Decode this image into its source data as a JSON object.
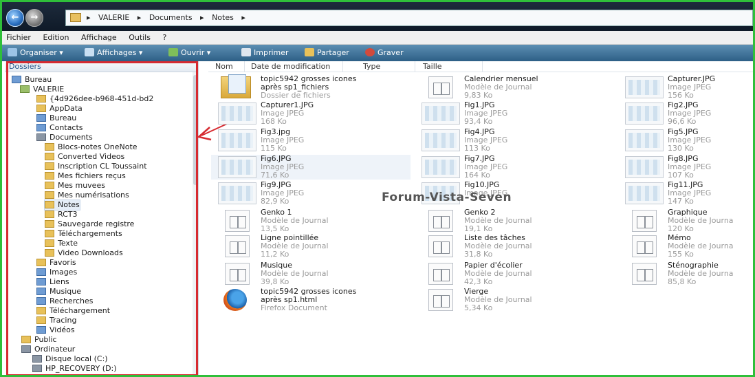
{
  "address": {
    "breadcrumbs": [
      "VALERIE",
      "Documents",
      "Notes"
    ]
  },
  "menu": [
    "Fichier",
    "Edition",
    "Affichage",
    "Outils",
    "?"
  ],
  "toolbar": {
    "organize": "Organiser",
    "views": "Affichages",
    "open": "Ouvrir",
    "print": "Imprimer",
    "share": "Partager",
    "burn": "Graver"
  },
  "left_pane": {
    "header": "Dossiers",
    "items": [
      {
        "label": "Bureau",
        "icon": "folder-blue-icon"
      },
      {
        "label": "VALERIE",
        "icon": "user-folder-icon"
      },
      {
        "label": "{4d926dee-b968-451d-bd2",
        "icon": "folder-icon"
      },
      {
        "label": "AppData",
        "icon": "folder-icon"
      },
      {
        "label": "Bureau",
        "icon": "folder-blue-icon"
      },
      {
        "label": "Contacts",
        "icon": "contacts-icon"
      },
      {
        "label": "Documents",
        "icon": "documents-icon"
      },
      {
        "label": "Blocs-notes OneNote",
        "icon": "folder-icon"
      },
      {
        "label": "Converted Videos",
        "icon": "folder-icon"
      },
      {
        "label": "Inscription CL Toussaint",
        "icon": "folder-icon"
      },
      {
        "label": "Mes fichiers reçus",
        "icon": "folder-icon"
      },
      {
        "label": "Mes muvees",
        "icon": "folder-icon"
      },
      {
        "label": "Mes numérisations",
        "icon": "folder-icon"
      },
      {
        "label": "Notes",
        "icon": "folder-icon"
      },
      {
        "label": "RCT3",
        "icon": "folder-icon"
      },
      {
        "label": "Sauvegarde registre",
        "icon": "folder-icon"
      },
      {
        "label": "Téléchargements",
        "icon": "folder-icon"
      },
      {
        "label": "Texte",
        "icon": "folder-icon"
      },
      {
        "label": "Video Downloads",
        "icon": "folder-icon"
      },
      {
        "label": "Favoris",
        "icon": "favorites-icon"
      },
      {
        "label": "Images",
        "icon": "images-icon"
      },
      {
        "label": "Liens",
        "icon": "links-icon"
      },
      {
        "label": "Musique",
        "icon": "music-icon"
      },
      {
        "label": "Recherches",
        "icon": "searches-icon"
      },
      {
        "label": "Téléchargement",
        "icon": "folder-icon"
      },
      {
        "label": "Tracing",
        "icon": "folder-icon"
      },
      {
        "label": "Vidéos",
        "icon": "videos-icon"
      },
      {
        "label": "Public",
        "icon": "folder-icon"
      },
      {
        "label": "Ordinateur",
        "icon": "computer-icon"
      },
      {
        "label": "Disque local (C:)",
        "icon": "drive-icon"
      },
      {
        "label": "HP_RECOVERY (D:)",
        "icon": "drive-icon"
      }
    ]
  },
  "columns": [
    "Nom",
    "Date de modification",
    "Type",
    "Taille"
  ],
  "files": [
    {
      "name": "topic5942 grosses icones",
      "name2": "après sp1_fichiers",
      "type": "Dossier de fichiers",
      "size": "",
      "icon": "folder-icon"
    },
    {
      "name": "Calendrier mensuel",
      "type": "Modèle de Journal",
      "size": "9,83 Ko",
      "icon": "journal-icon"
    },
    {
      "name": "Capturer.JPG",
      "type": "Image JPEG",
      "size": "156 Ko",
      "icon": "jpeg-icon"
    },
    {
      "name": "Capturer1.JPG",
      "type": "Image JPEG",
      "size": "168 Ko",
      "icon": "jpeg-icon"
    },
    {
      "name": "Fig1.JPG",
      "type": "Image JPEG",
      "size": "93,4 Ko",
      "icon": "jpeg-icon"
    },
    {
      "name": "Fig2.JPG",
      "type": "Image JPEG",
      "size": "96,6 Ko",
      "icon": "jpeg-icon"
    },
    {
      "name": "Fig3.jpg",
      "type": "Image JPEG",
      "size": "115 Ko",
      "icon": "jpeg-icon"
    },
    {
      "name": "Fig4.JPG",
      "type": "Image JPEG",
      "size": "113 Ko",
      "icon": "jpeg-icon"
    },
    {
      "name": "Fig5.JPG",
      "type": "Image JPEG",
      "size": "130 Ko",
      "icon": "jpeg-icon"
    },
    {
      "name": "Fig6.JPG",
      "type": "Image JPEG",
      "size": "71,6 Ko",
      "icon": "jpeg-icon"
    },
    {
      "name": "Fig7.JPG",
      "type": "Image JPEG",
      "size": "164 Ko",
      "icon": "jpeg-icon"
    },
    {
      "name": "Fig8.JPG",
      "type": "Image JPEG",
      "size": "107 Ko",
      "icon": "jpeg-icon"
    },
    {
      "name": "Fig9.JPG",
      "type": "Image JPEG",
      "size": "82,9 Ko",
      "icon": "jpeg-icon"
    },
    {
      "name": "Fig10.JPG",
      "type": "Image JPEG",
      "size": "",
      "icon": "jpeg-icon"
    },
    {
      "name": "Fig11.JPG",
      "type": "Image JPEG",
      "size": "147 Ko",
      "icon": "jpeg-icon"
    },
    {
      "name": "Genko 1",
      "type": "Modèle de Journal",
      "size": "13,5 Ko",
      "icon": "journal-icon"
    },
    {
      "name": "Genko 2",
      "type": "Modèle de Journal",
      "size": "19,1 Ko",
      "icon": "journal-icon"
    },
    {
      "name": "Graphique",
      "type": "Modèle de Journa",
      "size": "120 Ko",
      "icon": "journal-icon"
    },
    {
      "name": "Ligne pointillée",
      "type": "Modèle de Journal",
      "size": "11,2 Ko",
      "icon": "journal-icon"
    },
    {
      "name": "Liste des tâches",
      "type": "Modèle de Journal",
      "size": "31,8 Ko",
      "icon": "journal-icon"
    },
    {
      "name": "Mémo",
      "type": "Modèle de Journa",
      "size": "155 Ko",
      "icon": "journal-icon"
    },
    {
      "name": "Musique",
      "type": "Modèle de Journal",
      "size": "39,8 Ko",
      "icon": "journal-icon"
    },
    {
      "name": "Papier d'écolier",
      "type": "Modèle de Journal",
      "size": "42,3 Ko",
      "icon": "journal-icon"
    },
    {
      "name": "Sténographie",
      "type": "Modèle de Journa",
      "size": "85,8 Ko",
      "icon": "journal-icon"
    },
    {
      "name": "topic5942 grosses icones",
      "name2": "après sp1.html",
      "type": "Firefox Document",
      "size": "",
      "icon": "firefox-icon"
    },
    {
      "name": "Vierge",
      "type": "Modèle de Journal",
      "size": "5,34 Ko",
      "icon": "journal-icon"
    }
  ],
  "watermark": "Forum-Vista-Seven",
  "colors": {
    "highlight_box": "#d62a30",
    "frame": "#2fbf3a",
    "toolbar": "#2d5f86"
  }
}
